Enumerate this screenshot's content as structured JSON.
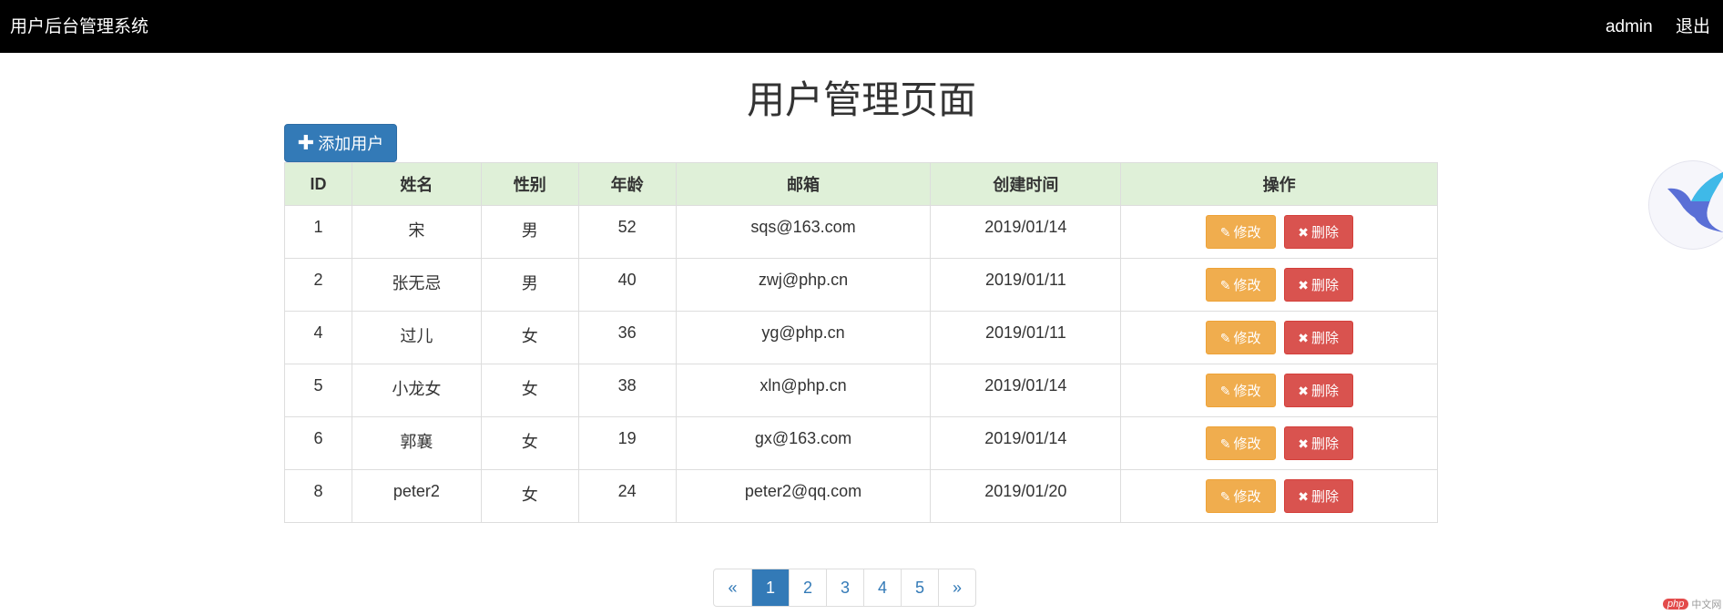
{
  "navbar": {
    "brand": "用户后台管理系统",
    "user": "admin",
    "logout": "退出"
  },
  "page": {
    "title": "用户管理页面",
    "add_button": "添加用户"
  },
  "table": {
    "headers": [
      "ID",
      "姓名",
      "性别",
      "年龄",
      "邮箱",
      "创建时间",
      "操作"
    ],
    "rows": [
      {
        "id": "1",
        "name": "宋",
        "gender": "男",
        "age": "52",
        "email": "sqs@163.com",
        "created": "2019/01/14"
      },
      {
        "id": "2",
        "name": "张无忌",
        "gender": "男",
        "age": "40",
        "email": "zwj@php.cn",
        "created": "2019/01/11"
      },
      {
        "id": "4",
        "name": "过儿",
        "gender": "女",
        "age": "36",
        "email": "yg@php.cn",
        "created": "2019/01/11"
      },
      {
        "id": "5",
        "name": "小龙女",
        "gender": "女",
        "age": "38",
        "email": "xln@php.cn",
        "created": "2019/01/14"
      },
      {
        "id": "6",
        "name": "郭襄",
        "gender": "女",
        "age": "19",
        "email": "gx@163.com",
        "created": "2019/01/14"
      },
      {
        "id": "8",
        "name": "peter2",
        "gender": "女",
        "age": "24",
        "email": "peter2@qq.com",
        "created": "2019/01/20"
      }
    ],
    "edit_label": "修改",
    "delete_label": "删除"
  },
  "pagination": {
    "prev": "«",
    "pages": [
      "1",
      "2",
      "3",
      "4",
      "5"
    ],
    "next": "»",
    "active": "1"
  },
  "watermark": {
    "logo": "php",
    "text": "中文网"
  },
  "colors": {
    "primary": "#337ab7",
    "warning": "#f0ad4e",
    "danger": "#d9534f",
    "header_bg": "#dff0d8",
    "navbar": "#000000"
  }
}
